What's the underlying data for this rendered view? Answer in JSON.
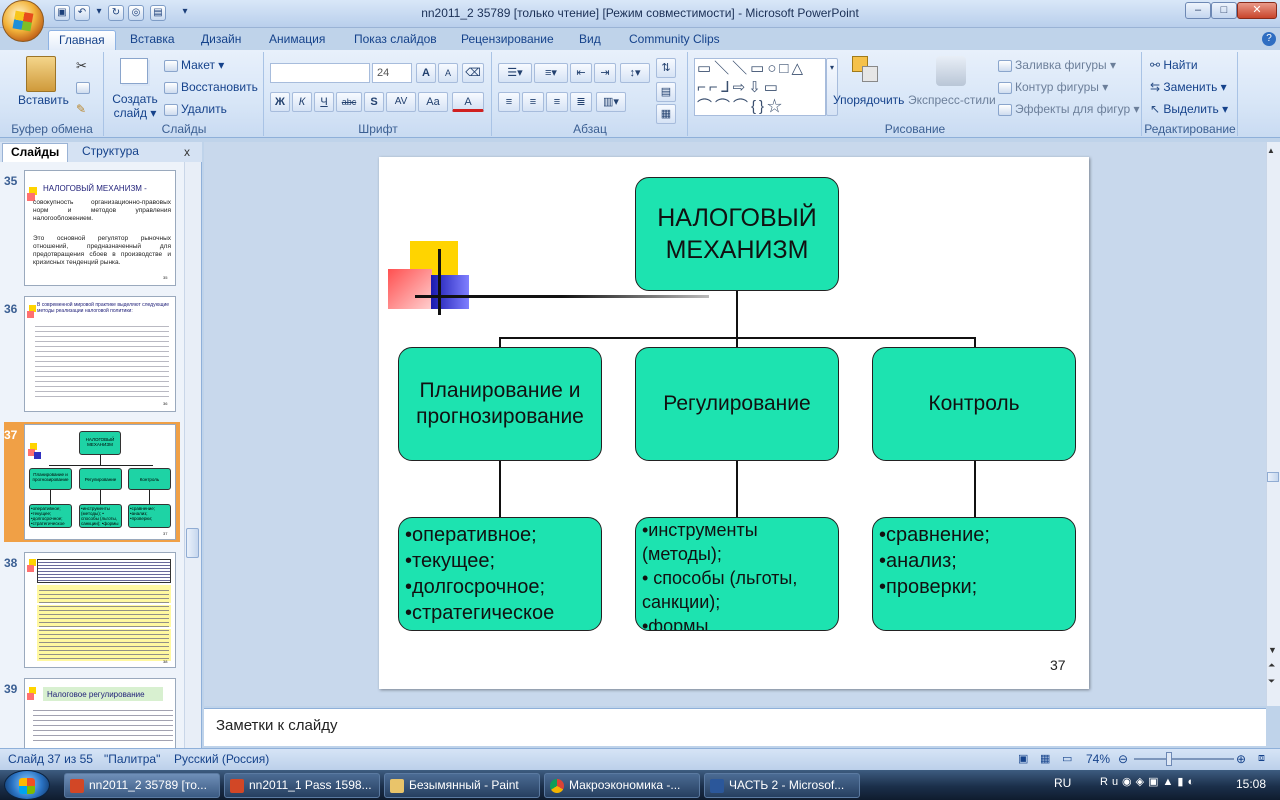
{
  "window": {
    "title": "nn2011_2 35789 [только чтение] [Режим совместимости] - Microsoft PowerPoint",
    "min": "–",
    "max": "□",
    "close": "✕"
  },
  "quick_access": [
    "save",
    "undo",
    "redo",
    "new",
    "open",
    "customize"
  ],
  "tabs": [
    "Главная",
    "Вставка",
    "Дизайн",
    "Анимация",
    "Показ слайдов",
    "Рецензирование",
    "Вид",
    "Community Clips"
  ],
  "ribbon": {
    "clipboard": {
      "paste": "Вставить",
      "label": "Буфер обмена"
    },
    "slides": {
      "new_slide": "Создать слайд ▾",
      "layout": "Макет ▾",
      "reset": "Восстановить",
      "delete": "Удалить",
      "label": "Слайды"
    },
    "font": {
      "name_value": "",
      "size_value": "24",
      "bold": "Ж",
      "italic": "К",
      "underline": "Ч",
      "strike": "abc",
      "shadow": "S",
      "spacing": "AV",
      "case": "Aa",
      "grow": "A",
      "shrink": "A",
      "color": "A",
      "label": "Шрифт"
    },
    "paragraph": {
      "label": "Абзац"
    },
    "drawing": {
      "arrange": "Упорядочить",
      "quick_styles": "Экспресс-стили",
      "fill": "Заливка фигуры ▾",
      "outline": "Контур фигуры ▾",
      "effects": "Эффекты для фигур ▾",
      "label": "Рисование"
    },
    "editing": {
      "find": "Найти",
      "replace": "Заменить ▾",
      "select": "Выделить ▾",
      "label": "Редактирование"
    }
  },
  "left_pane": {
    "tab_slides": "Слайды",
    "tab_outline": "Структура",
    "close": "x",
    "thumbs": [
      {
        "num": "35",
        "title": "НАЛОГОВЫЙ МЕХАНИЗМ -",
        "text1": "совокупность организационно-правовых норм и методов управления налогообложением.",
        "text2": "Это основной регулятор рыночных отношений, предназначенный для предотвращения сбоев в производстве и кризисных тенденций рынка.",
        "page": "35"
      },
      {
        "num": "36",
        "text": "В современной мировой практике выделяют следующие методы реализации налоговой политики:",
        "page": "36"
      },
      {
        "num": "37",
        "page": "37"
      },
      {
        "num": "38",
        "page": "38"
      },
      {
        "num": "39",
        "title": "Налоговое регулирование"
      }
    ]
  },
  "slide": {
    "root": "НАЛОГОВЫЙ МЕХАНИЗМ",
    "mid": [
      "Планирование и прогнозирование",
      "Регулирование",
      "Контроль"
    ],
    "bottom": [
      [
        "•оперативное;",
        "•текущее;",
        "•долгосрочное;",
        "•стратегическое"
      ],
      [
        "•инструменты (методы);",
        "• способы (льготы, санкции);",
        "•формы"
      ],
      [
        "•сравнение;",
        "•анализ;",
        "•проверки;"
      ]
    ],
    "page_number": "37",
    "colors": {
      "box": "#1de3b0",
      "accent_yellow": "#ffd400",
      "accent_red": "#ff6060",
      "accent_blue": "#3030c0"
    }
  },
  "notes": {
    "placeholder": "Заметки к слайду"
  },
  "status": {
    "slide": "Слайд 37 из 55",
    "theme": "\"Палитра\"",
    "lang": "Русский (Россия)",
    "zoom": "74%"
  },
  "taskbar": {
    "items": [
      "nn2011_2 35789 [то...",
      "nn2011_1 Pass 1598...",
      "Безымянный - Paint",
      "Макроэкономика -...",
      "ЧАСТЬ 2 - Microsof..."
    ],
    "lang": "RU",
    "clock": "15:08"
  }
}
